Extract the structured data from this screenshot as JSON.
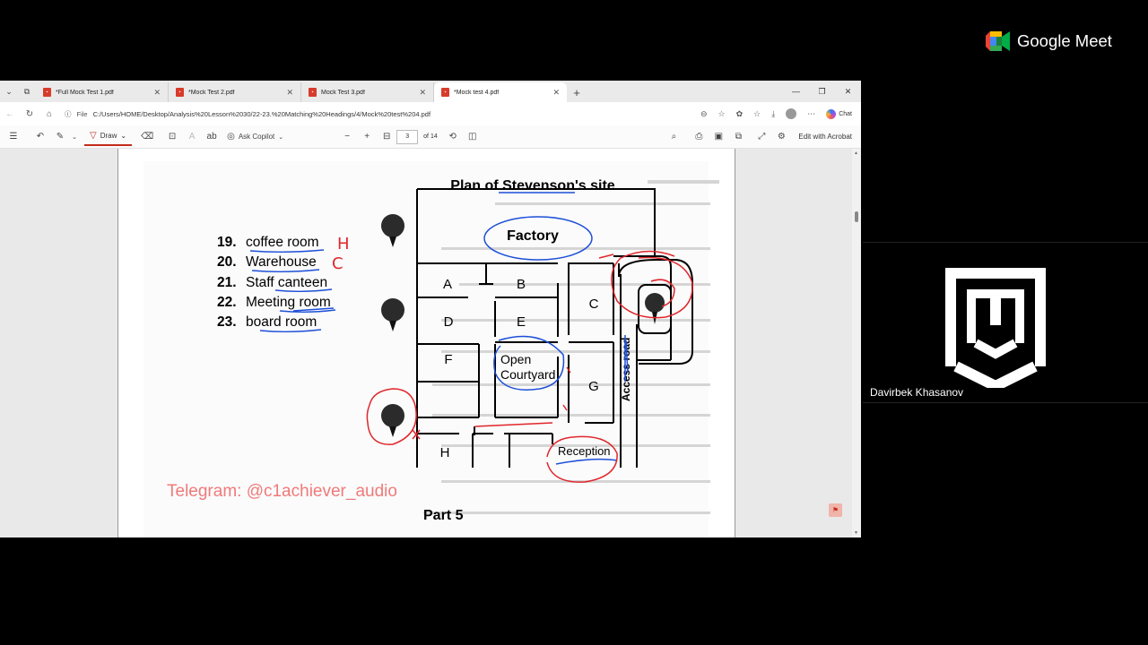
{
  "meet": {
    "brand": "Google Meet",
    "participant_name": "Davirbek Khasanov"
  },
  "browser": {
    "tabs": [
      {
        "title": "*Full Mock Test 1.pdf",
        "active": false
      },
      {
        "title": "*Mock Test 2.pdf",
        "active": false
      },
      {
        "title": "Mock Test 3.pdf",
        "active": false
      },
      {
        "title": "*Mock test 4.pdf",
        "active": true
      }
    ],
    "address": {
      "label": "File",
      "url": "C:/Users/HOME/Desktop/Analysis%20Lesson%2030/22-23.%20Matching%20Headings/4/Mock%20test%204.pdf"
    },
    "chat_label": "Chat"
  },
  "pdf_toolbar": {
    "draw_label": "Draw",
    "ask_copilot_label": "Ask Copilot",
    "page_current": "3",
    "page_total": "of 14",
    "edit_acrobat_label": "Edit with Acrobat"
  },
  "document": {
    "plan_title": "Plan of Stevenson's site",
    "questions": [
      {
        "num": "19.",
        "text": "coffee room",
        "answer": "H"
      },
      {
        "num": "20.",
        "text": "Warehouse",
        "answer": "C"
      },
      {
        "num": "21.",
        "text": "Staff canteen",
        "answer": ""
      },
      {
        "num": "22.",
        "text": "Meeting room",
        "answer": ""
      },
      {
        "num": "23.",
        "text": "board room",
        "answer": ""
      }
    ],
    "map_labels": {
      "factory": "Factory",
      "a": "A",
      "b": "B",
      "c": "C",
      "d": "D",
      "e": "E",
      "f": "F",
      "g": "G",
      "h": "H",
      "open": "Open",
      "courtyard": "Courtyard",
      "access_road": "Access road",
      "reception": "Reception"
    },
    "telegram": "Telegram: @c1achiever_audio",
    "part": "Part 5"
  },
  "colors": {
    "ink_red": "#e0262b",
    "ink_blue": "#1d4fd8",
    "accent_red": "#c42b1c",
    "telegram_pink": "#f07a7a"
  }
}
